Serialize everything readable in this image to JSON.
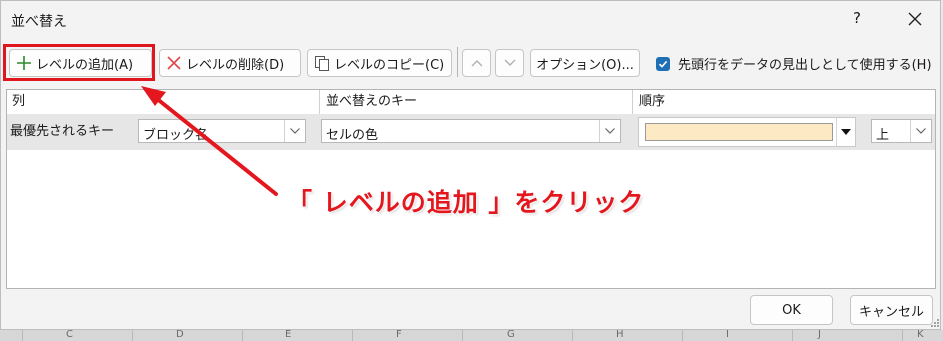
{
  "dialog": {
    "title": "並べ替え",
    "help": "?"
  },
  "toolbar": {
    "add_level": "レベルの追加(A)",
    "delete_level": "レベルの削除(D)",
    "copy_level": "レベルのコピー(C)",
    "up": "∧",
    "down": "∨",
    "options": "オプション(O)...",
    "header_checkbox_label": "先頭行をデータの見出しとして使用する(H)",
    "header_checkbox_checked": true
  },
  "grid": {
    "headers": [
      "列",
      "並べ替えのキー",
      "順序"
    ],
    "rows": [
      {
        "label": "最優先されるキー",
        "column": "ブロック名",
        "key": "セルの色",
        "order_color": "#fde9c3",
        "order": "上"
      }
    ]
  },
  "buttons": {
    "ok": "OK",
    "cancel": "キャンセル"
  },
  "annotation": {
    "text": "「 レベルの追加 」をクリック",
    "color": "#e4161e"
  },
  "background_columns": [
    "C",
    "D",
    "E",
    "F",
    "G",
    "H",
    "I",
    "J",
    "K"
  ]
}
